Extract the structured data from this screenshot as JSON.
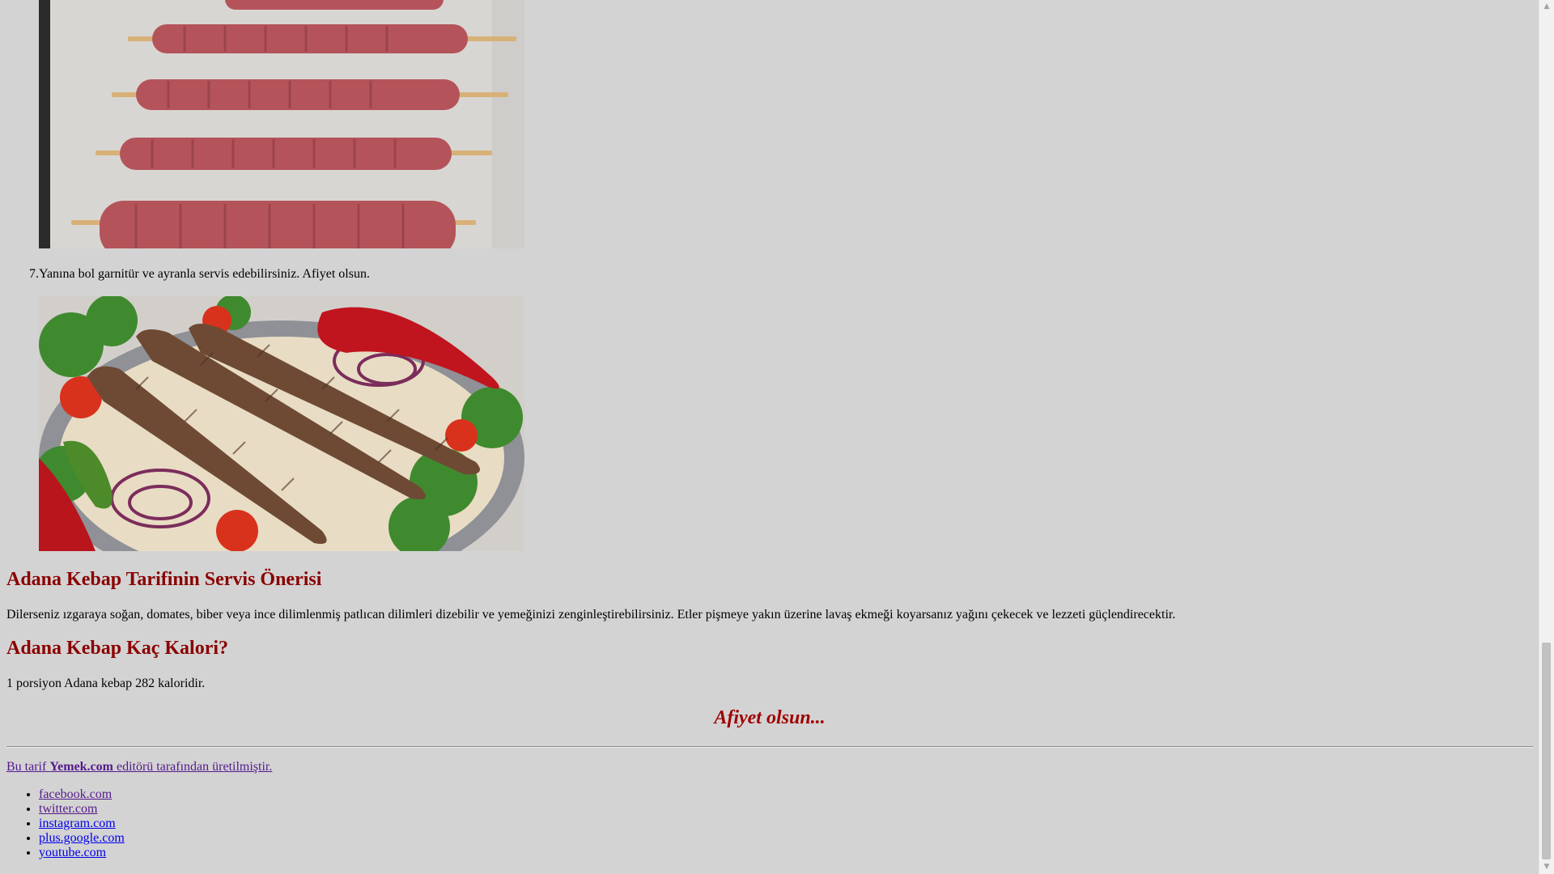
{
  "steps": [
    {
      "number": "7.",
      "text": "Yanına bol garnitür ve ayranla servis edebilirsiniz. Afiyet olsun."
    }
  ],
  "images": [
    {
      "name": "raw-kebab-skewers-photo"
    },
    {
      "name": "grilled-adana-kebab-plate-photo"
    }
  ],
  "sections": [
    {
      "title": "Adana Kebap Tarifinin Servis Önerisi",
      "text": "Dilerseniz ızgaraya soğan, domates, biber veya ince dilimlenmiş patlıcan dilimleri dizebilir ve yemeğinizi zenginleştirebilirsiniz. Etler pişmeye yakın üzerine lavaş ekmeği koyarsanız yağını çekecek ve lezzeti güçlendirecektir."
    },
    {
      "title": "Adana Kebap Kaç Kalori?",
      "text": "1 porsiyon Adana kebap 282 kaloridir."
    }
  ],
  "closing": "Afiyet olsun...",
  "credit": {
    "prefix": "Bu tarif ",
    "brand": "Yemek.com",
    "suffix": " editörü tarafından üretilmiştir."
  },
  "social_links": [
    "facebook.com",
    "twitter.com",
    "instagram.com",
    "plus.google.com",
    "youtube.com"
  ],
  "colors": {
    "background": "#d3d3d3",
    "heading": "#8b0000",
    "link": "#0000ee",
    "visited_link": "#551a8b"
  }
}
